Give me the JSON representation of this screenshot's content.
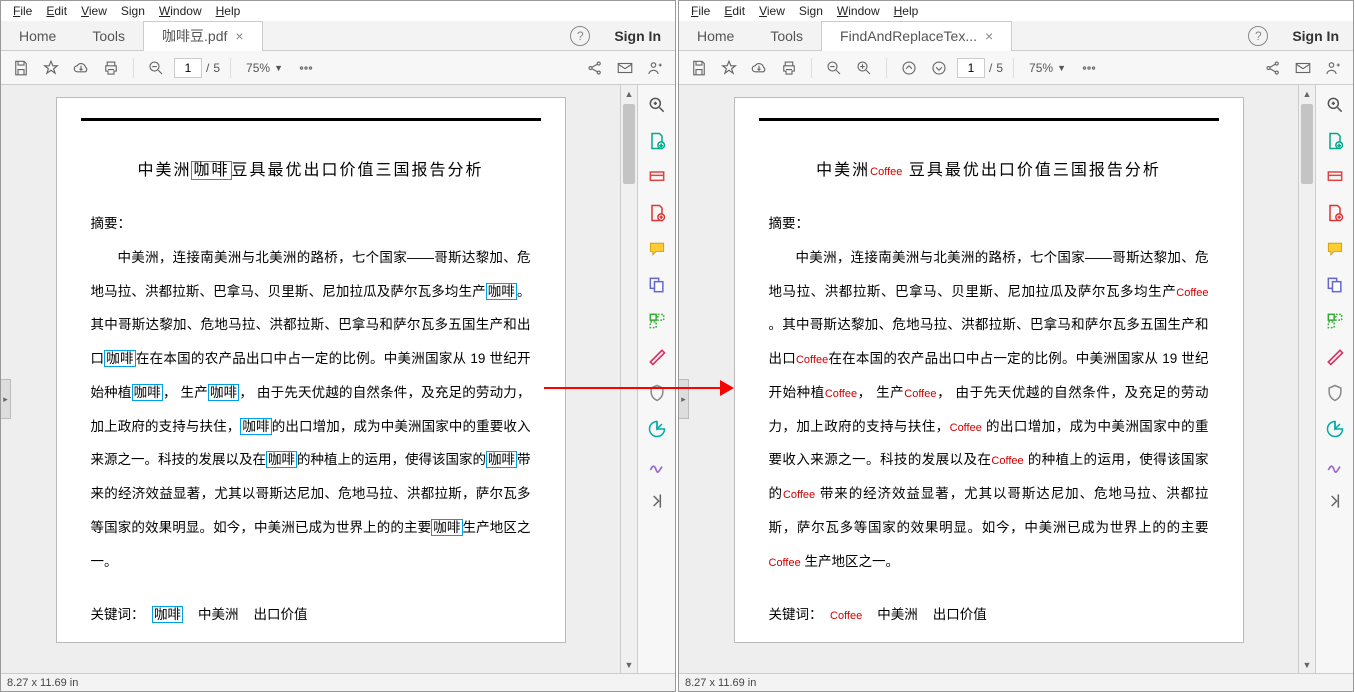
{
  "menus": [
    "File",
    "Edit",
    "View",
    "Sign",
    "Window",
    "Help"
  ],
  "tabs": {
    "home": "Home",
    "tools": "Tools"
  },
  "left": {
    "doc_tab": "咖啡豆.pdf",
    "page_current": "1",
    "page_total": "5",
    "zoom": "75%",
    "signin": "Sign In",
    "status": "8.27 x 11.69 in"
  },
  "right": {
    "doc_tab": "FindAndReplaceTex...",
    "page_current": "1",
    "page_total": "5",
    "zoom": "75%",
    "signin": "Sign In",
    "status": "8.27 x 11.69 in"
  },
  "doc": {
    "title_pre": "中美洲",
    "title_hl": "咖啡",
    "title_post": "豆具最优出口价值三国报告分析",
    "abstract": "摘要：",
    "p1_a": "中美洲，连接南美洲与北美洲的路桥，七个国家——哥斯达黎加、危地马拉、洪都拉斯、巴拿马、贝里斯、尼加拉瓜及萨尔瓦多均生产",
    "hl1": "咖啡",
    "p1_b": "。其中哥斯达黎加、危地马拉、洪都拉斯、巴拿马和萨尔瓦多五国生产和出口",
    "hl2": "咖啡",
    "p1_c": "在在本国的农产品出口中占一定的比例。中美洲国家从 19 世纪开始种植",
    "hl3": "咖啡",
    "p1_d": "， 生产",
    "hl4": "咖啡",
    "p1_e": "， 由于先天优越的自然条件，及充足的劳动力，加上政府的支持与扶住，",
    "hl5": "咖啡",
    "p1_f": "的出口增加，成为中美洲国家中的重要收入来源之一。科技的发展以及在",
    "hl6": "咖啡",
    "p1_g": "的种植上的运用，使得该国家的",
    "hl7": "咖啡",
    "p1_h": "带来的经济效益显著，尤其以哥斯达尼加、危地马拉、洪都拉斯，萨尔瓦多等国家的效果明显。如今，中美洲已成为世界上的的主要",
    "hl8": "咖啡",
    "p1_i": "生产地区之一。",
    "kw_label": "关键词：",
    "kw1": "咖啡",
    "kw2": "中美洲",
    "kw3": "出口价值",
    "coffee": "Coffee"
  }
}
